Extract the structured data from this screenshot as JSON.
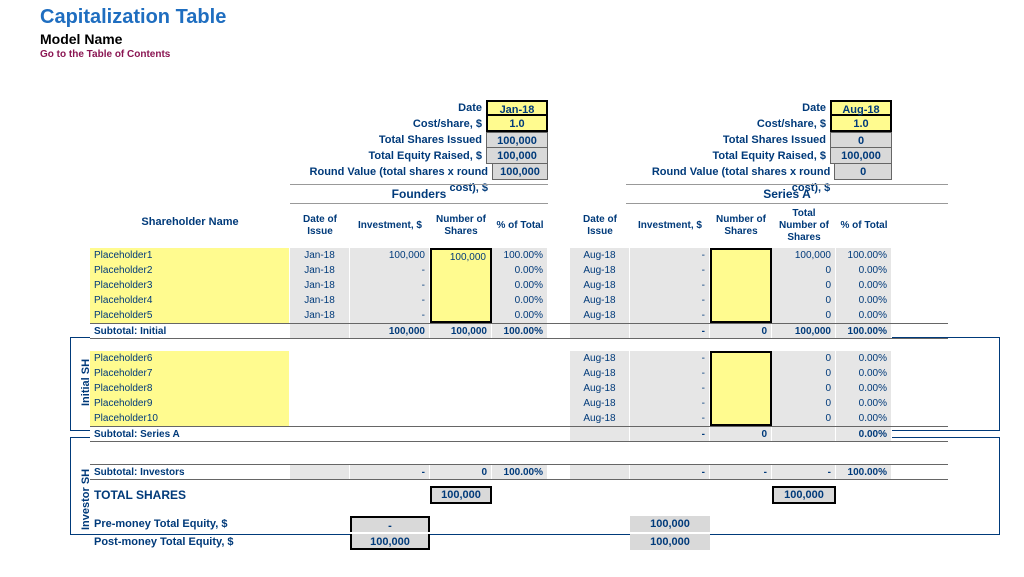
{
  "header": {
    "title": "Capitalization Table",
    "model": "Model Name",
    "toc": "Go to the Table of Contents"
  },
  "labels": {
    "date": "Date",
    "cost_share": "Cost/share, $",
    "total_shares_issued": "Total Shares Issued",
    "total_equity_raised": "Total Equity Raised, $",
    "round_value": "Round Value (total shares x round cost), $",
    "shareholder_name": "Shareholder Name",
    "date_of_issue": "Date of Issue",
    "investment": "Investment, $",
    "number_of_shares": "Number of Shares",
    "total_number_of_shares": "Total Number of Shares",
    "pct_of_total": "% of Total",
    "initial_sh": "Initial SH",
    "investor_sh": "Investor SH",
    "subtotal_initial": "Subtotal: Initial",
    "subtotal_series_a": "Subtotal: Series A",
    "subtotal_investors": "Subtotal: Investors",
    "total_shares": "TOTAL SHARES",
    "pre_money": "Pre-money Total Equity, $",
    "post_money": "Post-money Total Equity, $"
  },
  "rounds": [
    {
      "name": "Founders",
      "date": "Jan-18",
      "cost": "1.0",
      "shares_issued": "100,000",
      "equity_raised": "100,000",
      "round_value": "100,000",
      "has_total_col": false
    },
    {
      "name": "Series A",
      "date": "Aug-18",
      "cost": "1.0",
      "shares_issued": "0",
      "equity_raised": "100,000",
      "round_value": "0",
      "has_total_col": true
    }
  ],
  "initial": [
    {
      "name": "Placeholder1",
      "f": {
        "date": "Jan-18",
        "inv": "100,000",
        "num": "100,000",
        "pct": "100.00%"
      },
      "a": {
        "date": "Aug-18",
        "inv": "-",
        "num": "",
        "tot": "100,000",
        "pct": "100.00%"
      }
    },
    {
      "name": "Placeholder2",
      "f": {
        "date": "Jan-18",
        "inv": "-",
        "num": "",
        "pct": "0.00%"
      },
      "a": {
        "date": "Aug-18",
        "inv": "-",
        "num": "",
        "tot": "0",
        "pct": "0.00%"
      }
    },
    {
      "name": "Placeholder3",
      "f": {
        "date": "Jan-18",
        "inv": "-",
        "num": "",
        "pct": "0.00%"
      },
      "a": {
        "date": "Aug-18",
        "inv": "-",
        "num": "",
        "tot": "0",
        "pct": "0.00%"
      }
    },
    {
      "name": "Placeholder4",
      "f": {
        "date": "Jan-18",
        "inv": "-",
        "num": "",
        "pct": "0.00%"
      },
      "a": {
        "date": "Aug-18",
        "inv": "-",
        "num": "",
        "tot": "0",
        "pct": "0.00%"
      }
    },
    {
      "name": "Placeholder5",
      "f": {
        "date": "Jan-18",
        "inv": "-",
        "num": "",
        "pct": "0.00%"
      },
      "a": {
        "date": "Aug-18",
        "inv": "-",
        "num": "",
        "tot": "0",
        "pct": "0.00%"
      }
    }
  ],
  "subtotal_initial": {
    "f": {
      "inv": "100,000",
      "num": "100,000",
      "pct": "100.00%"
    },
    "a": {
      "inv": "-",
      "num": "0",
      "tot": "100,000",
      "pct": "100.00%"
    }
  },
  "investors": [
    {
      "name": "Placeholder6",
      "a": {
        "date": "Aug-18",
        "inv": "-",
        "num": "",
        "tot": "0",
        "pct": "0.00%"
      }
    },
    {
      "name": "Placeholder7",
      "a": {
        "date": "Aug-18",
        "inv": "-",
        "num": "",
        "tot": "0",
        "pct": "0.00%"
      }
    },
    {
      "name": "Placeholder8",
      "a": {
        "date": "Aug-18",
        "inv": "-",
        "num": "",
        "tot": "0",
        "pct": "0.00%"
      }
    },
    {
      "name": "Placeholder9",
      "a": {
        "date": "Aug-18",
        "inv": "-",
        "num": "",
        "tot": "0",
        "pct": "0.00%"
      }
    },
    {
      "name": "Placeholder10",
      "a": {
        "date": "Aug-18",
        "inv": "-",
        "num": "",
        "tot": "0",
        "pct": "0.00%"
      }
    }
  ],
  "subtotal_series_a": {
    "a": {
      "inv": "-",
      "num": "0",
      "tot": "",
      "pct": "0.00%"
    }
  },
  "subtotal_investors": {
    "f": {
      "inv": "-",
      "num": "0",
      "pct": "100.00%"
    },
    "a": {
      "inv": "-",
      "num": "-",
      "tot": "-",
      "pct": "100.00%"
    }
  },
  "total_shares": {
    "f": "100,000",
    "a": "100,000"
  },
  "equity": {
    "pre": {
      "f": "-",
      "a": "100,000"
    },
    "post": {
      "f": "100,000",
      "a": "100,000"
    }
  }
}
